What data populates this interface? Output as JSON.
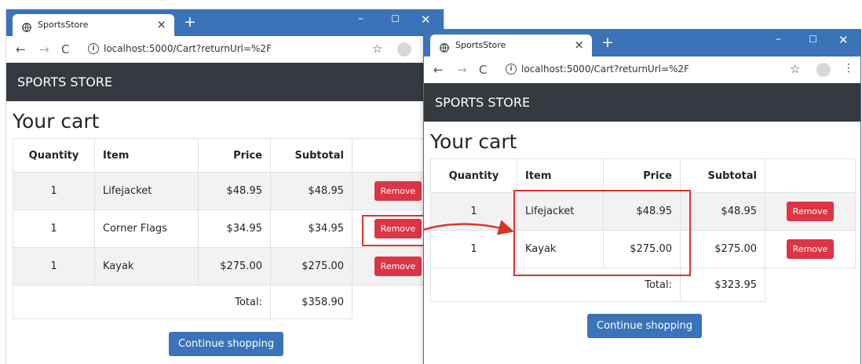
{
  "colors": {
    "titlebar": "#3b73b9",
    "navbar": "#343a40",
    "remove": "#dc3545",
    "continue": "#3b73b9",
    "highlight": "#d9342b"
  },
  "windows": [
    {
      "tab_title": "SportsStore",
      "url": "localhost:5000/Cart?returnUrl=%2F",
      "brand": "SPORTS STORE",
      "heading": "Your cart",
      "columns": [
        "Quantity",
        "Item",
        "Price",
        "Subtotal"
      ],
      "rows": [
        {
          "quantity": "1",
          "item": "Lifejacket",
          "price": "$48.95",
          "subtotal": "$48.95",
          "remove_label": "Remove"
        },
        {
          "quantity": "1",
          "item": "Corner Flags",
          "price": "$34.95",
          "subtotal": "$34.95",
          "remove_label": "Remove"
        },
        {
          "quantity": "1",
          "item": "Kayak",
          "price": "$275.00",
          "subtotal": "$275.00",
          "remove_label": "Remove"
        }
      ],
      "total_label": "Total:",
      "total_value": "$358.90",
      "continue_label": "Continue shopping"
    },
    {
      "tab_title": "SportsStore",
      "url": "localhost:5000/Cart?returnUrl=%2F",
      "brand": "SPORTS STORE",
      "heading": "Your cart",
      "columns": [
        "Quantity",
        "Item",
        "Price",
        "Subtotal"
      ],
      "rows": [
        {
          "quantity": "1",
          "item": "Lifejacket",
          "price": "$48.95",
          "subtotal": "$48.95",
          "remove_label": "Remove"
        },
        {
          "quantity": "1",
          "item": "Kayak",
          "price": "$275.00",
          "subtotal": "$275.00",
          "remove_label": "Remove"
        }
      ],
      "total_label": "Total:",
      "total_value": "$323.95",
      "continue_label": "Continue shopping"
    }
  ]
}
